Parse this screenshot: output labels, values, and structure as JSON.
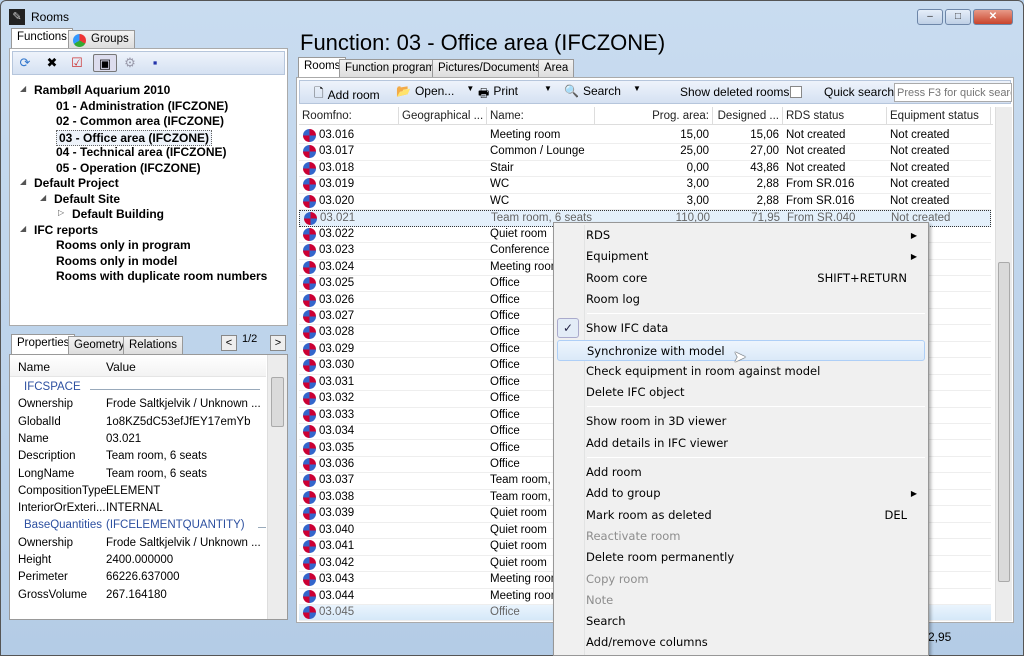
{
  "window": {
    "title": "Rooms",
    "buttons": {
      "minimize": "–",
      "maximize": "□",
      "close": "✕"
    }
  },
  "left": {
    "tabs": [
      {
        "label": "Functions"
      },
      {
        "label": "Groups"
      }
    ],
    "toolbar_icons": [
      "refresh-icon",
      "disconnect-icon",
      "checklist-icon",
      "view-icon",
      "settings-icon",
      "save-icon"
    ],
    "tree": [
      {
        "label": "Rambøll Aquarium 2010",
        "level": 0,
        "expander": "◢"
      },
      {
        "label": "01 - Administration (IFCZONE)",
        "level": 1
      },
      {
        "label": "02 - Common area (IFCZONE)",
        "level": 1
      },
      {
        "label": "03 - Office area (IFCZONE)",
        "level": 1,
        "selected": true
      },
      {
        "label": "04 - Technical area (IFCZONE)",
        "level": 1
      },
      {
        "label": "05 - Operation (IFCZONE)",
        "level": 1
      },
      {
        "label": "Default Project",
        "level": 0,
        "expander": "◢"
      },
      {
        "label": "Default Site",
        "level": 1,
        "expander": "◢"
      },
      {
        "label": "Default Building",
        "level": 2,
        "expander": "▷"
      },
      {
        "label": "IFC reports",
        "level": 0,
        "expander": "◢"
      },
      {
        "label": "Rooms only in program",
        "level": 1
      },
      {
        "label": "Rooms only in model",
        "level": 1
      },
      {
        "label": "Rooms with duplicate room numbers",
        "level": 1
      }
    ],
    "props_tabs": [
      {
        "label": "Properties"
      },
      {
        "label": "Geometry"
      },
      {
        "label": "Relations"
      }
    ],
    "props_page": "1/2",
    "prev": "<",
    "next": ">",
    "props_header": {
      "name": "Name",
      "value": "Value"
    },
    "props": [
      {
        "group": "IFCSPACE"
      },
      {
        "name": "Ownership",
        "value": "Frode Saltkjelvik / Unknown ..."
      },
      {
        "name": "GlobalId",
        "value": "1o8KZ5dC53efJfEY17emYb"
      },
      {
        "name": "Name",
        "value": "03.021"
      },
      {
        "name": "Description",
        "value": "Team room, 6 seats"
      },
      {
        "name": "LongName",
        "value": "Team room, 6 seats"
      },
      {
        "name": "CompositionType",
        "value": "ELEMENT"
      },
      {
        "name": "InteriorOrExteri...",
        "value": "INTERNAL"
      },
      {
        "group": "BaseQuantities",
        "group2": "(IFCELEMENTQUANTITY)"
      },
      {
        "name": "Ownership",
        "value": "Frode Saltkjelvik / Unknown ..."
      },
      {
        "name": "Height",
        "value": "2400.000000"
      },
      {
        "name": "Perimeter",
        "value": "66226.637000"
      },
      {
        "name": "GrossVolume",
        "value": "267.164180"
      }
    ]
  },
  "main": {
    "heading": "Function: 03 - Office area (IFCZONE)",
    "tabs": [
      {
        "label": "Rooms"
      },
      {
        "label": "Function program"
      },
      {
        "label": "Pictures/Documents"
      },
      {
        "label": "Area"
      }
    ],
    "toolbar": {
      "add_room": "Add room",
      "open": "Open...",
      "print": "Print",
      "search": "Search",
      "show_deleted": "Show deleted rooms",
      "quick_search": "Quick search",
      "quick_search_placeholder": "Press F3 for quick search"
    },
    "columns": [
      "Roomfno:",
      "Geographical ...",
      "Name:",
      "Prog. area:",
      "Designed ...",
      "RDS status",
      "Equipment status"
    ],
    "rows": [
      [
        "03.016",
        "",
        "Meeting room",
        "15,00",
        "15,06",
        "Not created",
        "Not created"
      ],
      [
        "03.017",
        "",
        "Common / Lounge",
        "25,00",
        "27,00",
        "Not created",
        "Not created"
      ],
      [
        "03.018",
        "",
        "Stair",
        "0,00",
        "43,86",
        "Not created",
        "Not created"
      ],
      [
        "03.019",
        "",
        "WC",
        "3,00",
        "2,88",
        "From SR.016",
        "Not created"
      ],
      [
        "03.020",
        "",
        "WC",
        "3,00",
        "2,88",
        "From SR.016",
        "Not created"
      ],
      [
        "03.021",
        "",
        "Team room, 6 seats",
        "110,00",
        "71,95",
        "From SR.040",
        "Not created"
      ],
      [
        "03.022",
        "",
        "Quiet room",
        "",
        "",
        "",
        "ated"
      ],
      [
        "03.023",
        "",
        "Conference",
        "",
        "",
        "",
        "ated"
      ],
      [
        "03.024",
        "",
        "Meeting room",
        "",
        "",
        "",
        ""
      ],
      [
        "03.025",
        "",
        "Office",
        "",
        "",
        "",
        "ated"
      ],
      [
        "03.026",
        "",
        "Office",
        "",
        "",
        "",
        "ated"
      ],
      [
        "03.027",
        "",
        "Office",
        "",
        "",
        "",
        "ated"
      ],
      [
        "03.028",
        "",
        "Office",
        "",
        "",
        "",
        "ated"
      ],
      [
        "03.029",
        "",
        "Office",
        "",
        "",
        "",
        "ated"
      ],
      [
        "03.030",
        "",
        "Office",
        "",
        "",
        "",
        "ated"
      ],
      [
        "03.031",
        "",
        "Office",
        "",
        "",
        "",
        "ated"
      ],
      [
        "03.032",
        "",
        "Office",
        "",
        "",
        "",
        "ated"
      ],
      [
        "03.033",
        "",
        "Office",
        "",
        "",
        "",
        "ated"
      ],
      [
        "03.034",
        "",
        "Office",
        "",
        "",
        "",
        "ated"
      ],
      [
        "03.035",
        "",
        "Office",
        "",
        "",
        "",
        "ated"
      ],
      [
        "03.036",
        "",
        "Office",
        "",
        "",
        "",
        "ated"
      ],
      [
        "03.037",
        "",
        "Team room,",
        "",
        "",
        "",
        "ated"
      ],
      [
        "03.038",
        "",
        "Team room,",
        "",
        "",
        "",
        "ated"
      ],
      [
        "03.039",
        "",
        "Quiet room",
        "",
        "",
        "",
        "ated"
      ],
      [
        "03.040",
        "",
        "Quiet room",
        "",
        "",
        "",
        "ated"
      ],
      [
        "03.041",
        "",
        "Quiet room",
        "",
        "",
        "",
        "ated"
      ],
      [
        "03.042",
        "",
        "Quiet room",
        "",
        "",
        "",
        "ated"
      ],
      [
        "03.043",
        "",
        "Meeting room",
        "",
        "",
        "",
        "ated"
      ],
      [
        "03.044",
        "",
        "Meeting room",
        "",
        "",
        "",
        "ated"
      ],
      [
        "03.045",
        "",
        "Office",
        "",
        "",
        "",
        "ated"
      ]
    ],
    "focused_row": "03.021",
    "status_total": "2,95"
  },
  "context_menu": {
    "items": [
      {
        "label": "RDS",
        "submenu": true
      },
      {
        "label": "Equipment",
        "submenu": true
      },
      {
        "label": "Room core",
        "shortcut": "SHIFT+RETURN"
      },
      {
        "label": "Room log"
      },
      {
        "sep": true
      },
      {
        "label": "Show IFC data",
        "checked": true
      },
      {
        "label": "Synchronize with model",
        "hover": true
      },
      {
        "label": "Check equipment in room against model"
      },
      {
        "label": "Delete IFC object"
      },
      {
        "sep": true
      },
      {
        "label": "Show room in 3D viewer"
      },
      {
        "label": "Add details in IFC viewer"
      },
      {
        "sep": true
      },
      {
        "label": "Add room"
      },
      {
        "label": "Add to group",
        "submenu": true
      },
      {
        "label": "Mark room as deleted",
        "shortcut": "DEL"
      },
      {
        "label": "Reactivate room",
        "disabled": true
      },
      {
        "label": "Delete room permanently"
      },
      {
        "label": "Copy room",
        "disabled": true
      },
      {
        "label": "Note",
        "disabled": true
      },
      {
        "label": "Search"
      },
      {
        "label": "Add/remove columns"
      }
    ]
  }
}
